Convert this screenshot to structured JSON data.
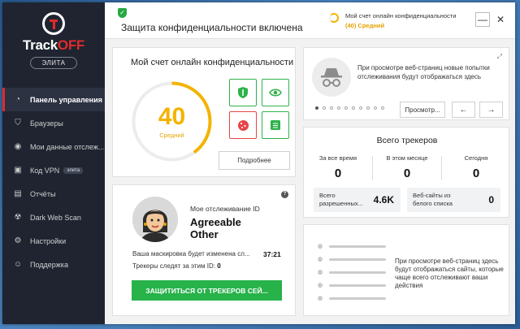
{
  "app": {
    "logo_track": "Track",
    "logo_off": "OFF",
    "tier": "ЭЛИТА"
  },
  "sidebar": {
    "items": [
      {
        "label": "Панель управления",
        "icon": "dashboard-icon",
        "active": true
      },
      {
        "label": "Браузеры",
        "icon": "shield-icon"
      },
      {
        "label": "Мои данные отслеж...",
        "icon": "eye-icon"
      },
      {
        "label": "Код VPN",
        "icon": "vpn-icon",
        "badge": "элита"
      },
      {
        "label": "Отчёты",
        "icon": "report-icon"
      },
      {
        "label": "Dark Web Scan",
        "icon": "dark-web-icon"
      },
      {
        "label": "Настройки",
        "icon": "gear-icon"
      },
      {
        "label": "Поддержка",
        "icon": "support-icon"
      }
    ]
  },
  "header": {
    "status_title": "Защита конфиденциальности включена",
    "account_label": "Мой счет онлайн конфиденциальности",
    "account_score": "(40) Средний",
    "minimize": "—",
    "close": "✕"
  },
  "privacy": {
    "title": "Мой счет онлайн конфиденциальности",
    "score": "40",
    "score_label": "Средний",
    "score_value": 40,
    "details_button": "Подробнее"
  },
  "tracker_info": {
    "text": "При просмотре веб-страниц новые попытки отслеживания будут отображаться здесь",
    "view_button": "Просмотр...",
    "prev": "←",
    "next": "→"
  },
  "totals": {
    "title": "Всего трекеров",
    "stats": [
      {
        "label": "За все время",
        "value": "0"
      },
      {
        "label": "В этом месяце",
        "value": "0"
      },
      {
        "label": "Сегодня",
        "value": "0"
      }
    ],
    "allowed_label": "Всего разрешенных...",
    "allowed_value": "4.6K",
    "whitelist_label": "Веб-сайты из белого списка",
    "whitelist_value": "0"
  },
  "site_list": {
    "text": "При просмотре веб-страниц здесь будут отображаться сайты, которые чаще всего отслеживают ваши действия"
  },
  "identity": {
    "help": "?",
    "label": "Мое отслеживание ID",
    "name": "Agreeable Other",
    "mask_text": "Ваша маскировка будет изменена сл...",
    "mask_time": "37:21",
    "trackers_text": "Трекеры следят за этим ID:",
    "trackers_value": "0",
    "protect_button": "ЗАЩИТИТЬСЯ ОТ ТРЕКЕРОВ СЕЙ..."
  },
  "colors": {
    "accent_red": "#e02b2b",
    "score_yellow": "#f3b300",
    "green": "#27b24a",
    "sidebar": "#1f2430"
  }
}
